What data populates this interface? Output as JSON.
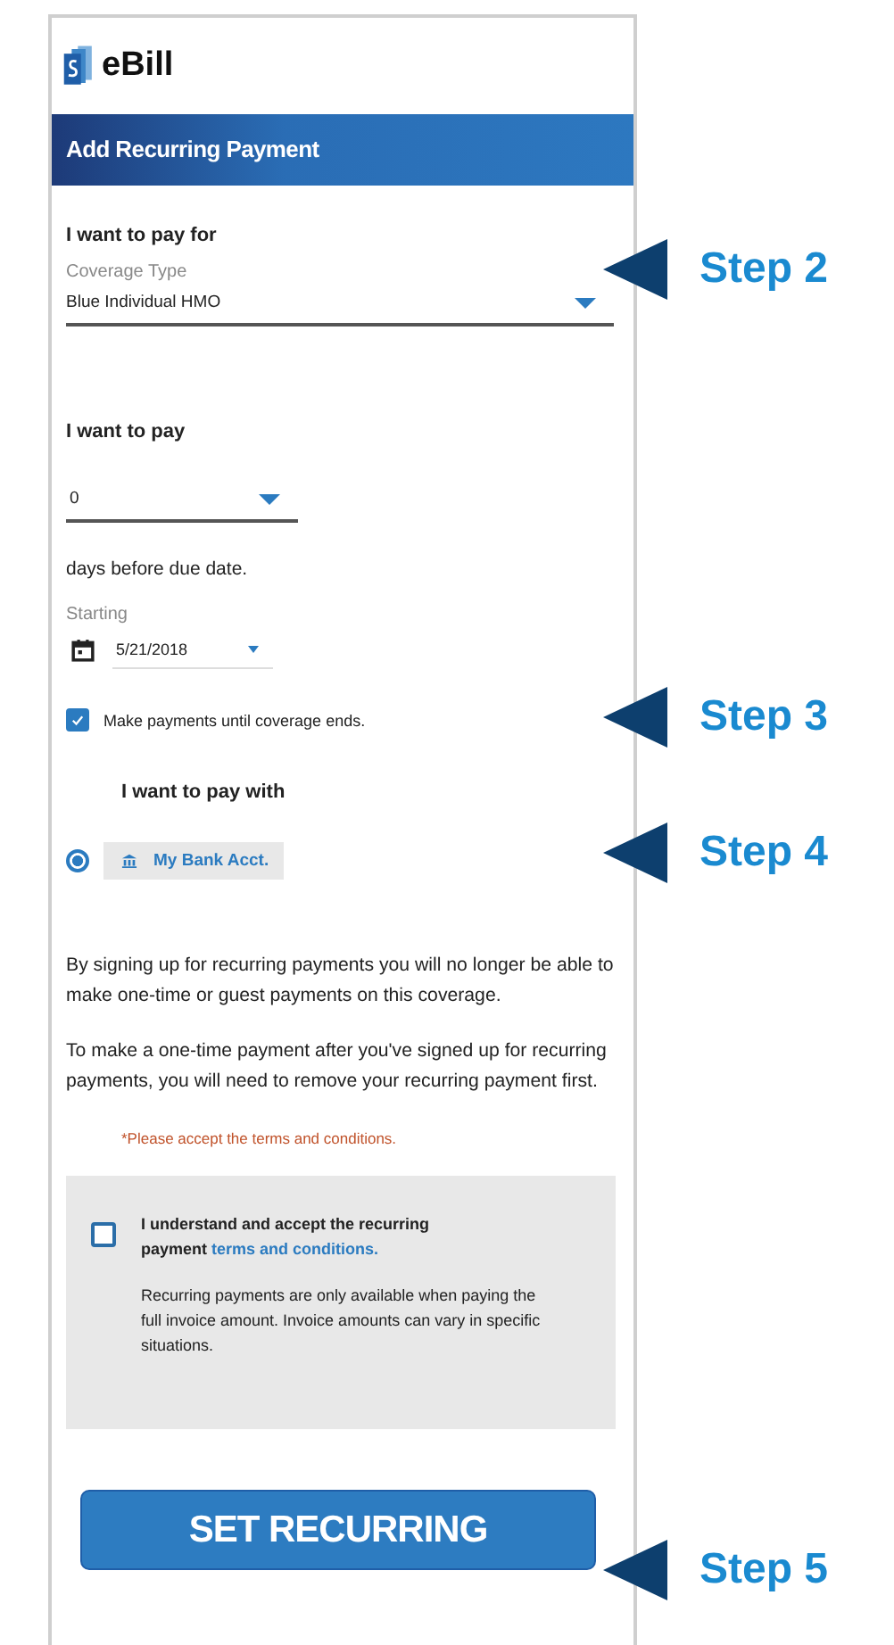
{
  "app": {
    "name": "eBill"
  },
  "header": {
    "title": "Add Recurring Payment"
  },
  "pay_for": {
    "heading": "I want to pay for",
    "label": "Coverage Type",
    "value": "Blue Individual HMO"
  },
  "pay_days": {
    "heading": "I want to pay",
    "value": "0",
    "suffix": "days before due date."
  },
  "starting": {
    "label": "Starting",
    "value": "5/21/2018"
  },
  "until_coverage_ends": {
    "label": "Make payments until coverage ends.",
    "checked": true
  },
  "pay_with": {
    "heading": "I want to pay with",
    "options": [
      {
        "label": "My Bank Acct.",
        "selected": true
      }
    ]
  },
  "notices": [
    "By signing up for recurring payments you will no longer be able to make one-time or guest payments on this coverage.",
    "To make a one-time payment after you've signed up for recurring payments, you will need to remove your recurring payment first."
  ],
  "error": "*Please accept the terms and conditions.",
  "terms": {
    "checked": false,
    "text": "I understand and accept the recurring payment",
    "link": "terms and conditions.",
    "note": "Recurring payments are only available when paying the full invoice amount. Invoice amounts can vary in specific situations."
  },
  "submit": "SET RECURRING",
  "callouts": [
    {
      "label": "Step 2"
    },
    {
      "label": "Step 3"
    },
    {
      "label": "Step 4"
    },
    {
      "label": "Step 5"
    }
  ]
}
